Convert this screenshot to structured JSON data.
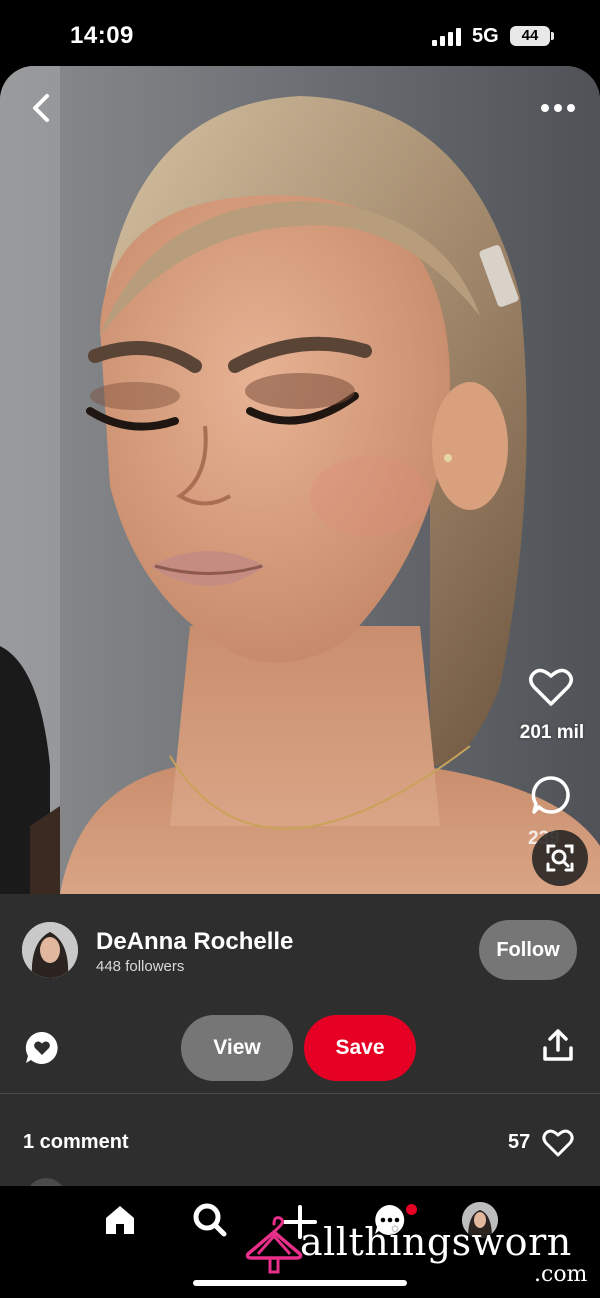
{
  "status_bar": {
    "time": "14:09",
    "network": "5G",
    "battery": "44"
  },
  "pin": {
    "back_icon": "chevron-left-icon",
    "more_icon": "ellipsis-icon",
    "like_count": "201 mil",
    "comment_count_partial": "239"
  },
  "creator": {
    "name": "DeAnna Rochelle",
    "followers": "448 followers",
    "follow_label": "Follow"
  },
  "actions": {
    "view_label": "View",
    "save_label": "Save",
    "save_color": "#e60023"
  },
  "comments": {
    "label": "1 comment",
    "reaction_count": "57"
  },
  "bottom_nav": {
    "items": [
      "home-icon",
      "search-icon",
      "create-icon",
      "messages-icon",
      "profile-icon"
    ],
    "has_notification": true
  },
  "watermark": {
    "brand": "allthingsworn",
    "suffix": ".com",
    "accent": "#e8308a"
  }
}
